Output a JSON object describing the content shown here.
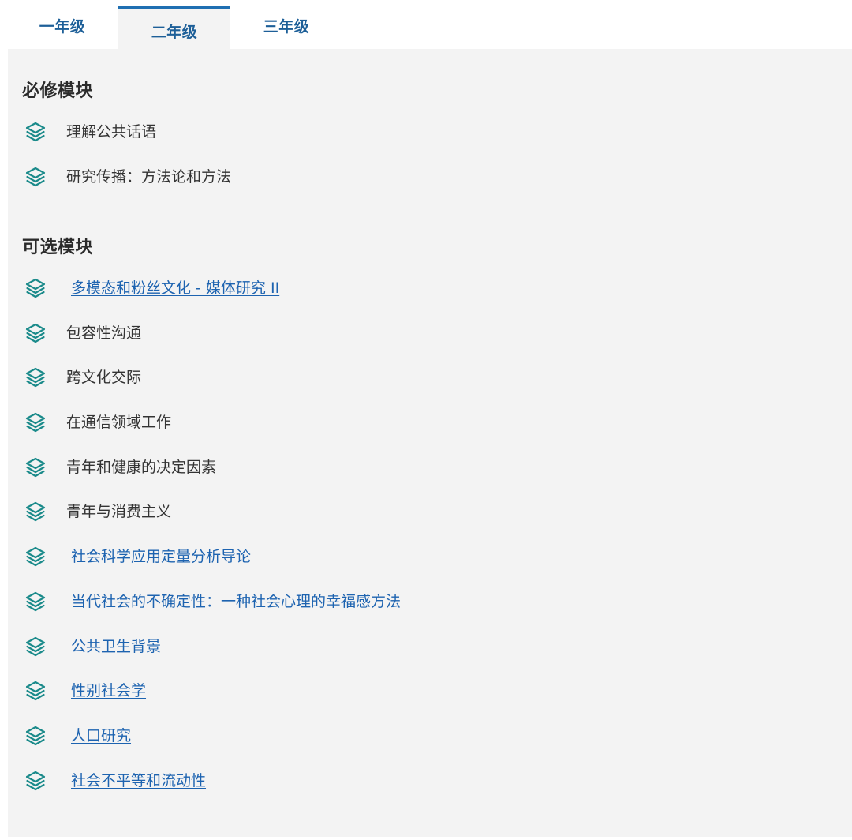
{
  "tabs": [
    {
      "label": "一年级",
      "active": false
    },
    {
      "label": "二年级",
      "active": true
    },
    {
      "label": "三年级",
      "active": false
    }
  ],
  "compulsory": {
    "title": "必修模块",
    "items": [
      {
        "label": "理解公共话语",
        "link": false
      },
      {
        "label": "研究传播：方法论和方法",
        "link": false
      }
    ]
  },
  "optional": {
    "title": "可选模块",
    "items": [
      {
        "label": "多模态和粉丝文化 - 媒体研究 II",
        "link": true
      },
      {
        "label": "包容性沟通",
        "link": false
      },
      {
        "label": "跨文化交际",
        "link": false
      },
      {
        "label": "在通信领域工作",
        "link": false
      },
      {
        "label": "青年和健康的决定因素",
        "link": false
      },
      {
        "label": "青年与消费主义",
        "link": false
      },
      {
        "label": "社会科学应用定量分析导论",
        "link": true
      },
      {
        "label": "当代社会的不确定性：一种社会心理的幸福感方法",
        "link": true
      },
      {
        "label": "公共卫生背景",
        "link": true
      },
      {
        "label": "性别社会学",
        "link": true
      },
      {
        "label": "人口研究",
        "link": true
      },
      {
        "label": "社会不平等和流动性",
        "link": true
      }
    ]
  },
  "colors": {
    "tab_text": "#1d5f98",
    "tab_active_border": "#1f6fb2",
    "panel_bg": "#f3f3f3",
    "icon": "#1a8a8a",
    "link": "#1d63b0",
    "text": "#333333"
  },
  "icons": {
    "module": "layers-icon"
  }
}
